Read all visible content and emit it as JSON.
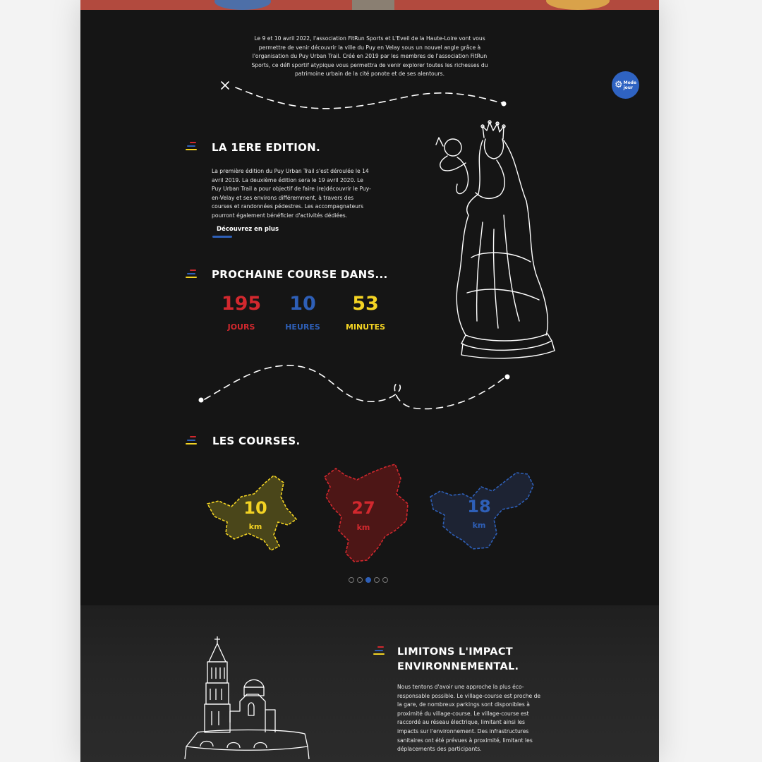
{
  "intro": {
    "text": "Le 9 et 10 avril 2022, l'association FitRun Sports et L'Eveil de la Haute-Loire vont vous permettre de venir découvrir la ville du Puy en Velay sous un nouvel angle grâce à l'organisation du Puy Urban Trail. Créé en 2019 par les membres de l'association FitRun Sports, ce défi sportif atypique vous permettra de venir explorer toutes les richesses du patrimoine urbain de la cité ponote et de ses alentours."
  },
  "mode_toggle": {
    "line1": "Mode",
    "line2": "jour",
    "icon": "gear-icon"
  },
  "edition": {
    "title": "LA 1ERE EDITION.",
    "text": "La première édition du Puy Urban Trail s'est déroulée le 14 avril 2019. La deuxième édition sera le 19 avril 2020. Le Puy Urban Trail a pour objectif de faire (re)découvrir le Puy-en-Velay et ses environs différemment, à travers des courses et randonnées pédestres. Les accompagnateurs pourront également bénéficier d'activités dédiées.",
    "link": "Découvrez en plus"
  },
  "countdown": {
    "title": "PROCHAINE COURSE DANS...",
    "items": [
      {
        "value": "195",
        "unit": "JOURS",
        "color": "#d2282e"
      },
      {
        "value": "10",
        "unit": "HEURES",
        "color": "#2e5fb7"
      },
      {
        "value": "53",
        "unit": "MINUTES",
        "color": "#f3d323"
      }
    ]
  },
  "courses": {
    "title": "LES COURSES.",
    "items": [
      {
        "distance": "10",
        "unit": "km",
        "color": "#f3d323",
        "fill": "#4a461a"
      },
      {
        "distance": "27",
        "unit": "km",
        "color": "#d2282e",
        "fill": "#4d1616"
      },
      {
        "distance": "18",
        "unit": "km",
        "color": "#2e5fb7",
        "fill": "#1d2333"
      }
    ],
    "carousel": {
      "count": 5,
      "active": 3
    }
  },
  "environment": {
    "title_line1": "LIMITONS L'IMPACT",
    "title_line2": "ENVIRONNEMENTAL.",
    "text": "Nous tentons d'avoir une approche la plus éco-responsable possible. Le village-course est proche de la gare, de nombreux parkings sont disponibles à proximité du village-course. Le village-course est raccordé au réseau électrique, limitant ainsi les impacts sur l'environnement. Des infrastructures sanitaires ont été prévues à proximité, limitant les déplacements des participants."
  },
  "colors": {
    "red": "#d2282e",
    "blue": "#2e5fb7",
    "yellow": "#f3d323",
    "background": "#151515"
  }
}
